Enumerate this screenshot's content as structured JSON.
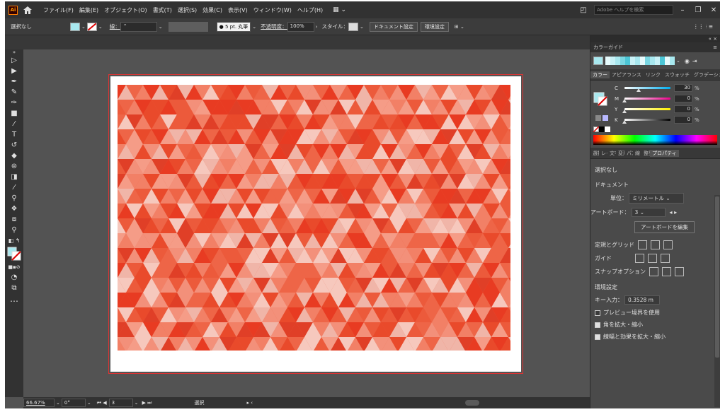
{
  "app": {
    "logo": "Ai"
  },
  "menubar": {
    "items": [
      "ファイル(F)",
      "編集(E)",
      "オブジェクト(O)",
      "書式(T)",
      "選択(S)",
      "効果(C)",
      "表示(V)",
      "ウィンドウ(W)",
      "ヘルプ(H)"
    ],
    "search_placeholder": "Adobe ヘルプを検索"
  },
  "controlbar": {
    "selection_label": "選択なし",
    "stroke_label": "線：",
    "brush_label": "5 pt. 丸筆",
    "opacity_label": "不透明度：",
    "opacity_value": "100%",
    "style_label": "スタイル：",
    "doc_settings": "ドキュメント設定",
    "preferences": "環境設定"
  },
  "colorguide": {
    "title": "カラーガイド"
  },
  "color_panel": {
    "tabs": [
      "カラー",
      "アピアランス",
      "リンク",
      "スウォッチ",
      "グラデーション"
    ],
    "sliders": [
      {
        "label": "C",
        "value": "30",
        "fill": 0.3
      },
      {
        "label": "M",
        "value": "0",
        "fill": 0
      },
      {
        "label": "Y",
        "value": "0",
        "fill": 0
      },
      {
        "label": "K",
        "value": "0",
        "fill": 0
      }
    ],
    "unit": "%"
  },
  "props_tabs": [
    "選択",
    "レイヤー",
    "文字",
    "変形",
    "パスファインダー",
    "線",
    "整列",
    "プロパティ"
  ],
  "properties": {
    "selection": "選択なし",
    "document_heading": "ドキュメント",
    "unit_label": "単位：",
    "unit_value": "ミリメートル",
    "artboard_label": "アートボード：",
    "artboard_value": "3",
    "edit_artboard_btn": "アートボードを編集",
    "rulers_grid_label": "定規とグリッド",
    "guides_label": "ガイド",
    "snap_label": "スナップオプション",
    "prefs_heading": "環境設定",
    "key_input_label": "キー入力：",
    "key_input_value": "0.3528 m",
    "opt1": "プレビュー境界を使用",
    "opt2": "角を拡大・縮小",
    "opt3": "線幅と効果を拡大・縮小",
    "opt1_checked": false,
    "opt2_checked": true,
    "opt3_checked": true
  },
  "statusbar": {
    "zoom": "66.67%",
    "rotation": "0°",
    "artboard_num": "3",
    "tool": "選択"
  },
  "colors": {
    "fill": "#a8e8ef",
    "accent": "#e94a2b"
  }
}
